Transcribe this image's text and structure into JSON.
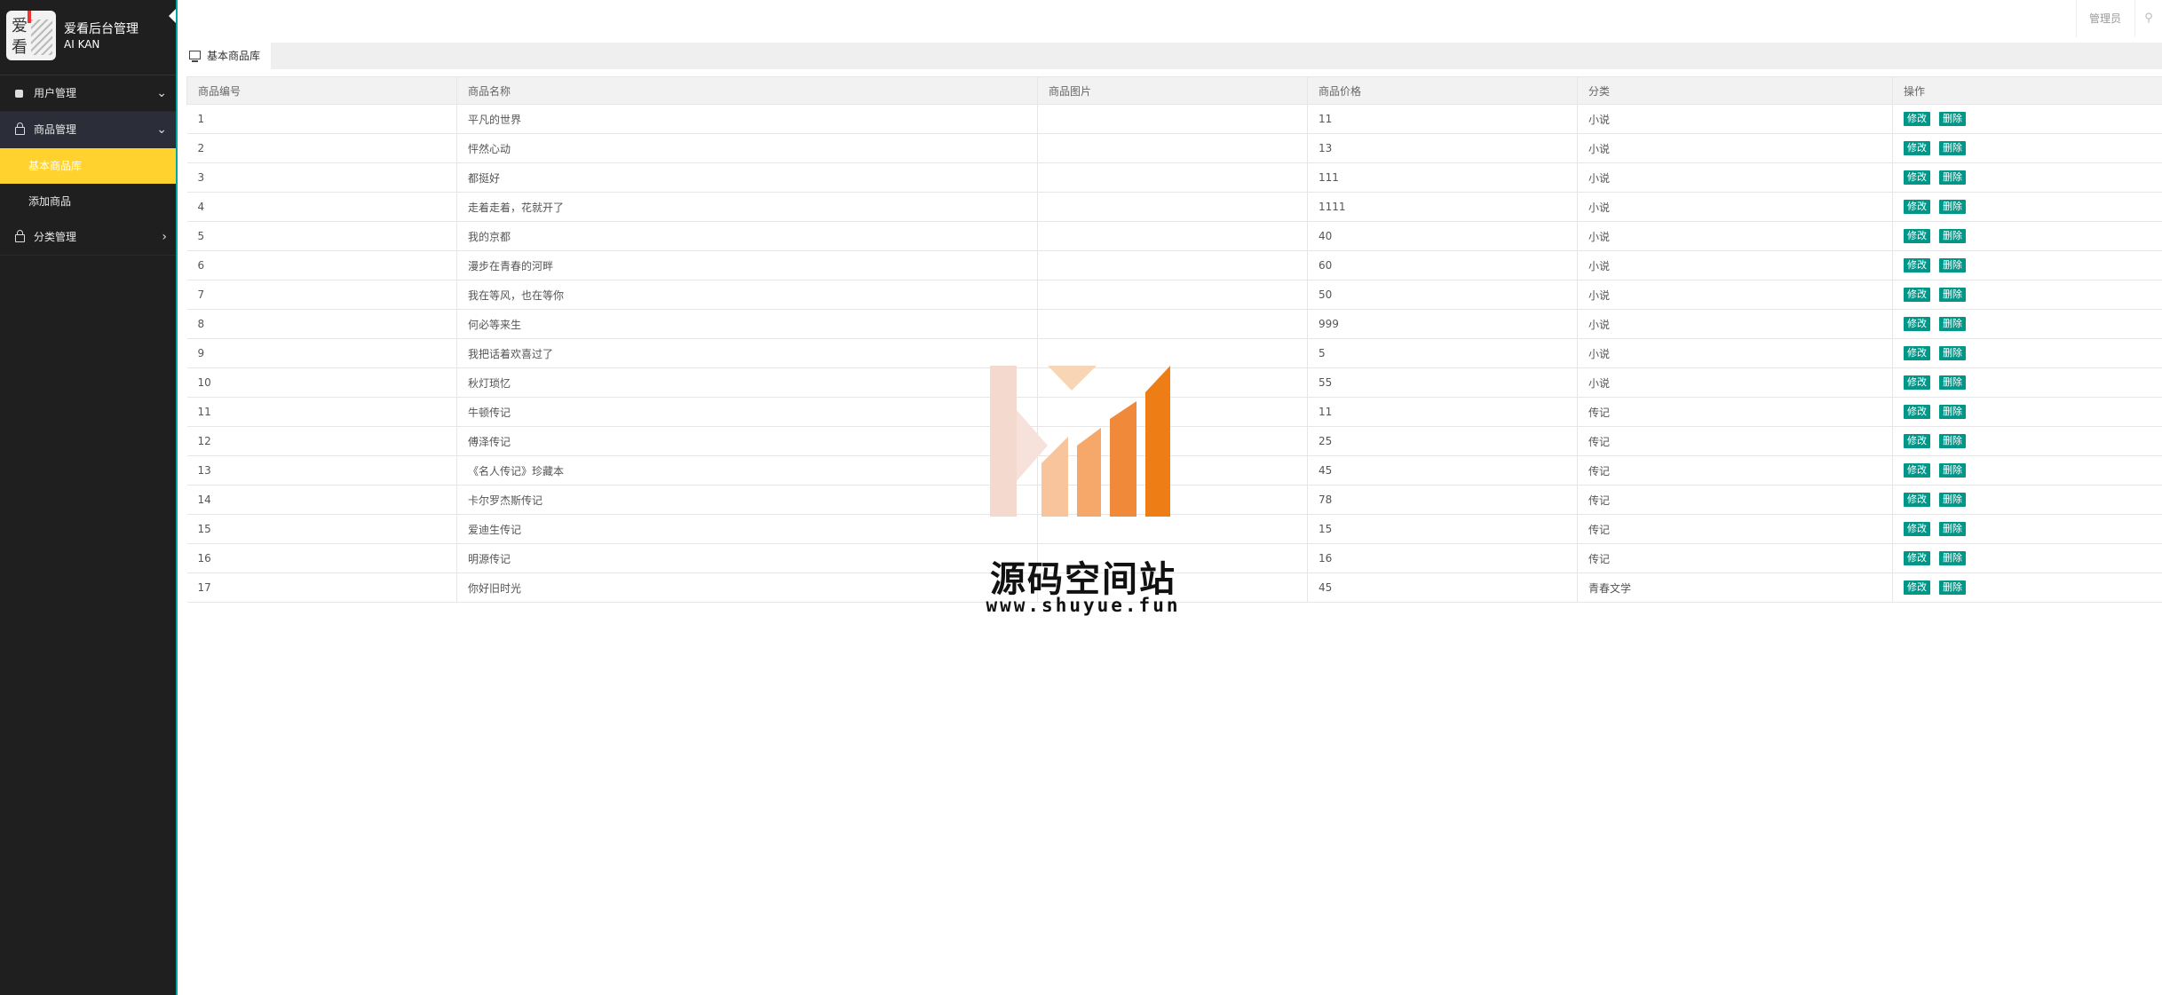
{
  "brand": {
    "logo_chars": [
      "爱",
      "看"
    ],
    "title": "爱看后台管理",
    "subtitle": "AI KAN"
  },
  "sidebar": {
    "items": [
      {
        "label": "用户管理",
        "icon": "user-icon",
        "state": "collapsed"
      },
      {
        "label": "商品管理",
        "icon": "lock-icon",
        "state": "expanded",
        "children": [
          {
            "label": "基本商品库",
            "active": true
          },
          {
            "label": "添加商品",
            "active": false
          }
        ]
      },
      {
        "label": "分类管理",
        "icon": "lock-icon",
        "state": "collapsed"
      }
    ]
  },
  "header": {
    "admin_label": "管理员",
    "logout_icon": "logout-icon"
  },
  "tab": {
    "label": "基本商品库",
    "icon": "monitor-icon"
  },
  "table": {
    "columns": [
      "商品编号",
      "商品名称",
      "商品图片",
      "商品价格",
      "分类",
      "操作"
    ],
    "rows": [
      {
        "id": "1",
        "name": "平凡的世界",
        "image": "",
        "price": "11",
        "category": "小说"
      },
      {
        "id": "2",
        "name": "怦然心动",
        "image": "",
        "price": "13",
        "category": "小说"
      },
      {
        "id": "3",
        "name": "都挺好",
        "image": "",
        "price": "111",
        "category": "小说"
      },
      {
        "id": "4",
        "name": "走着走着，花就开了",
        "image": "",
        "price": "1111",
        "category": "小说"
      },
      {
        "id": "5",
        "name": "我的京都",
        "image": "",
        "price": "40",
        "category": "小说"
      },
      {
        "id": "6",
        "name": "漫步在青春的河畔",
        "image": "",
        "price": "60",
        "category": "小说"
      },
      {
        "id": "7",
        "name": "我在等风，也在等你",
        "image": "",
        "price": "50",
        "category": "小说"
      },
      {
        "id": "8",
        "name": "何必等来生",
        "image": "",
        "price": "999",
        "category": "小说"
      },
      {
        "id": "9",
        "name": "我把话着欢喜过了",
        "image": "",
        "price": "5",
        "category": "小说"
      },
      {
        "id": "10",
        "name": "秋灯琐忆",
        "image": "",
        "price": "55",
        "category": "小说"
      },
      {
        "id": "11",
        "name": "牛顿传记",
        "image": "",
        "price": "11",
        "category": "传记"
      },
      {
        "id": "12",
        "name": "傅泽传记",
        "image": "",
        "price": "25",
        "category": "传记"
      },
      {
        "id": "13",
        "name": "《名人传记》珍藏本",
        "image": "",
        "price": "45",
        "category": "传记"
      },
      {
        "id": "14",
        "name": "卡尔罗杰斯传记",
        "image": "",
        "price": "78",
        "category": "传记"
      },
      {
        "id": "15",
        "name": "爱迪生传记",
        "image": "",
        "price": "15",
        "category": "传记"
      },
      {
        "id": "16",
        "name": "明源传记",
        "image": "",
        "price": "16",
        "category": "传记"
      },
      {
        "id": "17",
        "name": "你好旧时光",
        "image": "",
        "price": "45",
        "category": "青春文学"
      }
    ],
    "actions": {
      "edit": "修改",
      "delete": "删除"
    }
  },
  "watermark": {
    "title": "源码空间站",
    "url": "www.shuyue.fun"
  },
  "colors": {
    "sidebar_bg": "#1f1f1f",
    "active_item": "#ffd22d",
    "button": "#009688",
    "accent_border": "#00a99d"
  }
}
